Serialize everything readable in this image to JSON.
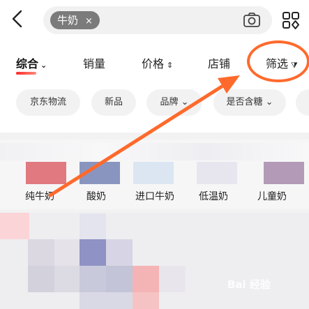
{
  "header": {
    "search_query": "牛奶",
    "clear_symbol": "×"
  },
  "sort_tabs": [
    {
      "label": "综合",
      "suffix": "⌄"
    },
    {
      "label": "销量",
      "suffix": ""
    },
    {
      "label": "价格",
      "suffix": "⇕"
    },
    {
      "label": "店铺",
      "suffix": ""
    },
    {
      "label": "筛选",
      "suffix": "⧩"
    }
  ],
  "filter_chips": [
    {
      "label": "京东物流"
    },
    {
      "label": "新品"
    },
    {
      "label": "品牌 ⌄"
    },
    {
      "label": "是否含糖 ⌄"
    }
  ],
  "categories": [
    {
      "label": "纯牛奶",
      "color": "#e07a80"
    },
    {
      "label": "酸奶",
      "color": "#8a95bf"
    },
    {
      "label": "进口牛奶",
      "color": "#dbe6f2"
    },
    {
      "label": "低温奶",
      "color": "#e7e6ee"
    },
    {
      "label": "儿童奶",
      "color": "#b39ab7"
    }
  ],
  "watermark": "Bai 经验",
  "annotation_color": "#ff6a2c"
}
